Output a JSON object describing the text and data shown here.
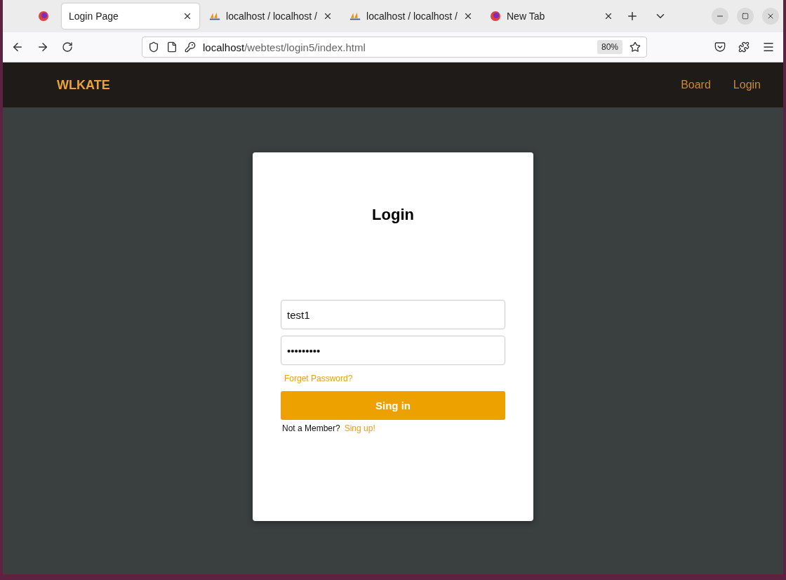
{
  "browser": {
    "tabs": [
      {
        "kind": "pinned",
        "selected": false
      },
      {
        "kind": "page",
        "title": "Login Page",
        "selected": true
      },
      {
        "kind": "pma",
        "title": "localhost / localhost /",
        "selected": false
      },
      {
        "kind": "pma",
        "title": "localhost / localhost /",
        "selected": false
      },
      {
        "kind": "newtab",
        "title": "New Tab",
        "selected": false
      }
    ],
    "url_host": "localhost",
    "url_path": "/webtest/login5/index.html",
    "zoom": "80%"
  },
  "navbar": {
    "brand": "WLKATE",
    "links": [
      "Board",
      "Login"
    ]
  },
  "login": {
    "title": "Login",
    "username": "test1",
    "password": "•••••••••",
    "forgot": "Forget Password?",
    "submit": "Sing in",
    "prompt": "Not a Member?",
    "signup": "Sing up!"
  }
}
